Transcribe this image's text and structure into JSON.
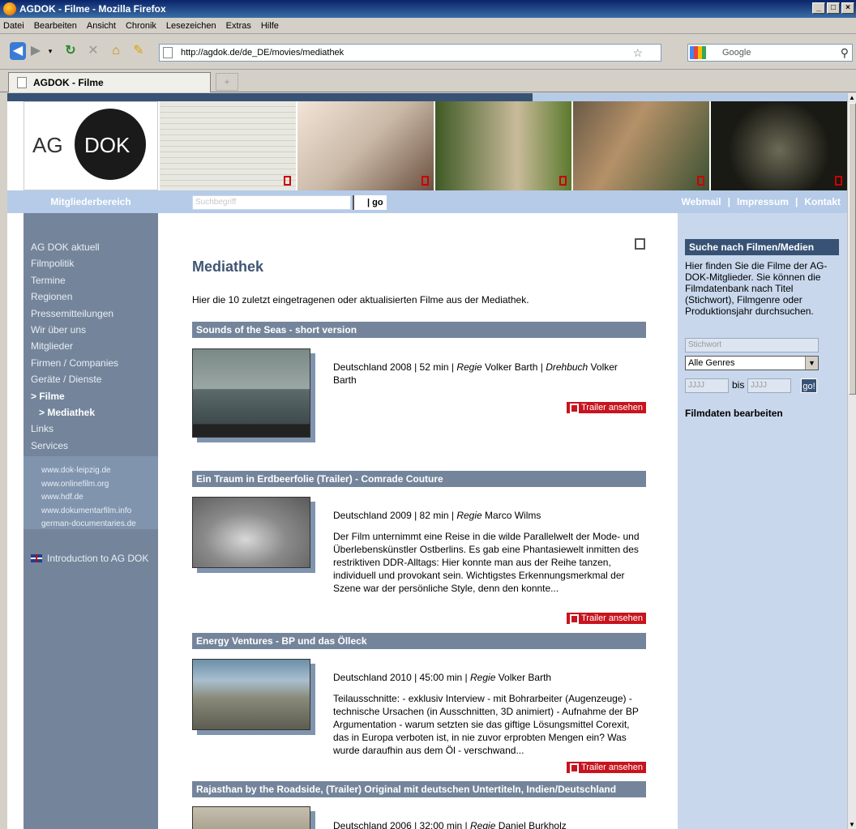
{
  "window": {
    "title": "AGDOK - Filme - Mozilla Firefox"
  },
  "menubar": [
    "Datei",
    "Bearbeiten",
    "Ansicht",
    "Chronik",
    "Lesezeichen",
    "Extras",
    "Hilfe"
  ],
  "navbar": {
    "url": "http://agdok.de/de_DE/movies/mediathek",
    "search_placeholder": "Google"
  },
  "tabs": [
    {
      "label": "AGDOK - Filme"
    }
  ],
  "header": {
    "logo_ag": "AG",
    "logo_dok": "DOK",
    "member_area": "Mitgliederbereich",
    "search_placeholder": "Suchbegriff",
    "go": "| go",
    "links": [
      "Webmail",
      "|",
      "Impressum",
      "|",
      "Kontakt"
    ]
  },
  "sidebar": {
    "items": [
      {
        "label": "AG DOK aktuell"
      },
      {
        "label": "Filmpolitik"
      },
      {
        "label": "Termine"
      },
      {
        "label": "Regionen"
      },
      {
        "label": "Pressemitteilungen"
      },
      {
        "label": "Wir über uns"
      },
      {
        "label": "Mitglieder"
      },
      {
        "label": "Firmen / Companies"
      },
      {
        "label": "Geräte / Dienste"
      },
      {
        "label": "> Filme"
      },
      {
        "label": "> Mediathek"
      },
      {
        "label": "Links"
      },
      {
        "label": "Services"
      }
    ],
    "external": [
      "www.dok-leipzig.de",
      "www.onlinefilm.org",
      "www.hdf.de",
      "www.dokumentarfilm.info",
      "german-documentaries.de"
    ],
    "intro": "Introduction to AG DOK"
  },
  "main": {
    "title": "Mediathek",
    "intro": "Hier die 10 zuletzt eingetragenen oder aktualisierten Filme aus der Mediathek.",
    "trailer_label": "Trailer ansehen",
    "entries": [
      {
        "title": "Sounds of the Seas - short version",
        "meta_pre": "Deutschland 2008 | 52 min | ",
        "regie_label": "Regie",
        "regie": " Volker Barth | ",
        "extra_label": "Drehbuch",
        "extra": " Volker Barth",
        "desc": ""
      },
      {
        "title": "Ein Traum in Erdbeerfolie (Trailer) - Comrade Couture",
        "meta_pre": "Deutschland 2009 | 82 min | ",
        "regie_label": "Regie",
        "regie": " Marco Wilms",
        "desc": "Der Film unternimmt eine Reise in die wilde Parallelwelt der Mode- und Überlebenskünstler Ostberlins. Es gab eine Phantasiewelt inmitten des restriktiven DDR-Alltags: Hier konnte man aus der Reihe tanzen, individuell und provokant sein. Wichtigstes Erkennungsmerkmal der Szene war der persönliche Style, denn den konnte..."
      },
      {
        "title": "Energy Ventures - BP und das Ölleck",
        "meta_pre": "Deutschland 2010 | 45:00 min | ",
        "regie_label": "Regie",
        "regie": " Volker Barth",
        "desc": "Teilausschnitte: - exklusiv Interview - mit Bohrarbeiter (Augenzeuge) - technische Ursachen (in Ausschnitten, 3D animiert) - Aufnahme der BP Argumentation - warum setzten sie das giftige Lösungsmittel Corexit, das in Europa verboten ist, in nie zuvor erprobten Mengen ein? Was wurde daraufhin aus dem Öl - verschwand..."
      },
      {
        "title": "Rajasthan by the Roadside, (Trailer) Original mit deutschen Untertiteln, Indien/Deutschland",
        "meta_pre": "Deutschland 2006 | 32:00 min | ",
        "regie_label": "Regie",
        "regie": " Daniel Burkholz",
        "desc": ""
      }
    ]
  },
  "rightcol": {
    "heading": "Suche nach Filmen/Medien",
    "text": "Hier finden Sie die Filme der AG-DOK-Mitglieder. Sie können die Filmdatenbank nach Titel (Stichwort), Filmgenre oder Produktionsjahr durchsuchen.",
    "stichwort": "Stichwort",
    "genre": "Alle Genres",
    "year_placeholder": "JJJJ",
    "bis": "bis",
    "go": "go!",
    "edit": "Filmdaten bearbeiten"
  }
}
